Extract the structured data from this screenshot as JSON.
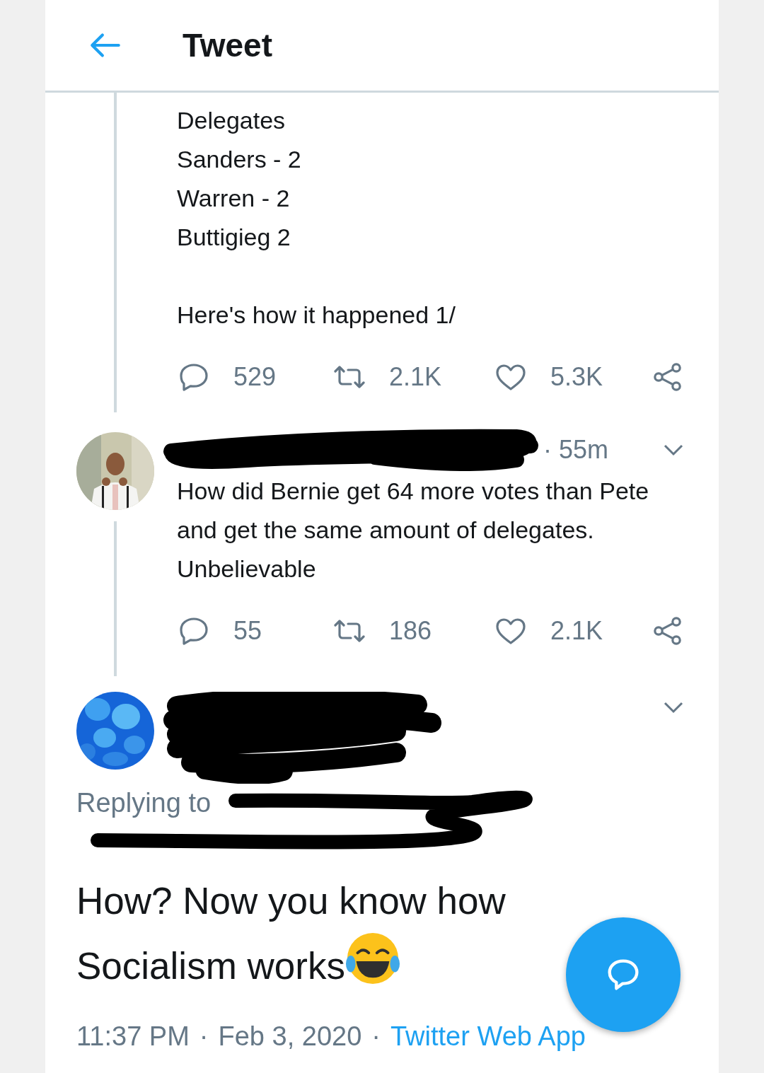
{
  "header": {
    "title": "Tweet"
  },
  "previous_tweet": {
    "paragraphs": [
      "Delegates\nSanders - 2\nWarren - 2\nButtigieg 2",
      "Here's how it happened 1/"
    ],
    "actions": {
      "replies": "529",
      "retweets": "2.1K",
      "likes": "5.3K"
    }
  },
  "reply_tweet": {
    "time": "· 55m",
    "text": "How did Bernie get 64 more votes than Pete and get the same amount of delegates. Unbelievable",
    "actions": {
      "replies": "55",
      "retweets": "186",
      "likes": "2.1K"
    }
  },
  "main_tweet": {
    "replying_label": "Replying to",
    "text": "How? Now you know how Socialism works",
    "time": "11:37 PM",
    "separator_1": "·",
    "date": "Feb 3, 2020",
    "separator_2": "·",
    "source": "Twitter Web App"
  },
  "compose_button": {
    "kind": "reply"
  }
}
